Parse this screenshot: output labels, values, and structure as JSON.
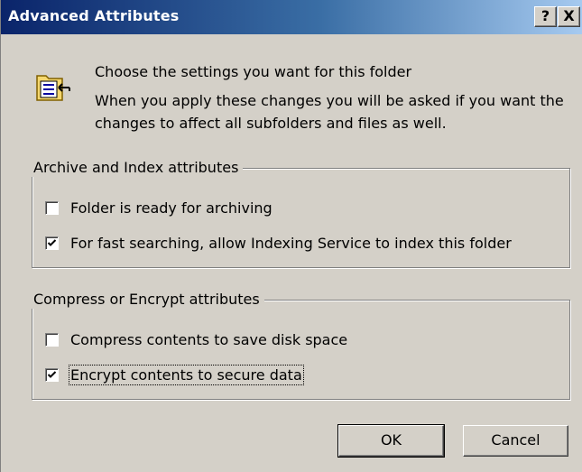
{
  "window": {
    "title": "Advanced Attributes",
    "help_button": "?",
    "close_button": "X"
  },
  "header": {
    "icon": "folder-properties-icon",
    "line1": "Choose the settings you want for this folder",
    "line2": "When you apply these changes you will be asked if you want the changes to affect all subfolders and files as well."
  },
  "archive_group": {
    "legend": "Archive and Index attributes",
    "items": [
      {
        "label": "Folder is ready for archiving",
        "checked": false
      },
      {
        "label": "For fast searching, allow Indexing Service to index this folder",
        "checked": true
      }
    ]
  },
  "compress_group": {
    "legend": "Compress or Encrypt attributes",
    "items": [
      {
        "label": "Compress contents to save disk space",
        "checked": false
      },
      {
        "label": "Encrypt contents to secure data",
        "checked": true
      }
    ]
  },
  "buttons": {
    "ok": "OK",
    "cancel": "Cancel"
  }
}
